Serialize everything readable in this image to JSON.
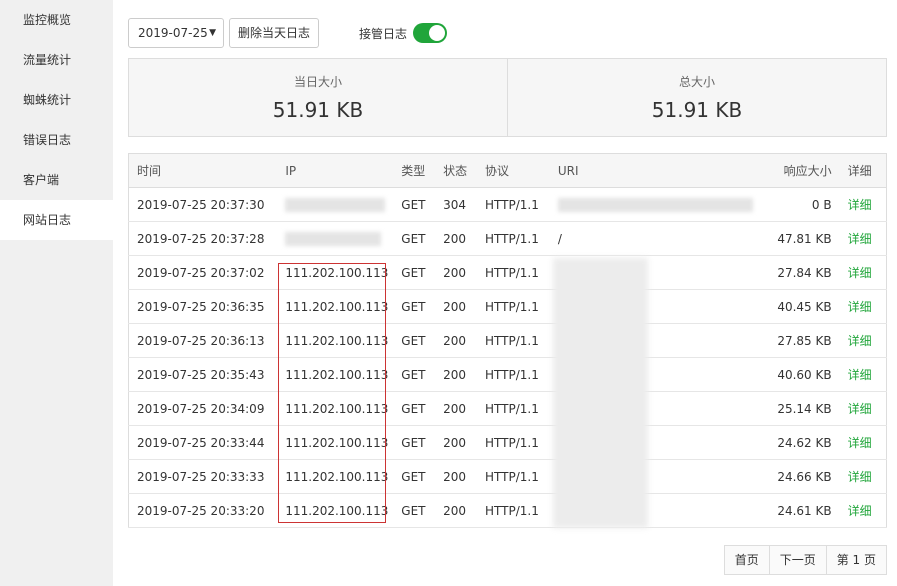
{
  "sidebar": {
    "items": [
      {
        "label": "监控概览"
      },
      {
        "label": "流量统计"
      },
      {
        "label": "蜘蛛统计"
      },
      {
        "label": "错误日志"
      },
      {
        "label": "客户端"
      },
      {
        "label": "网站日志",
        "active": true
      }
    ]
  },
  "toolbar": {
    "date_value": "2019-07-25",
    "delete_label": "删除当天日志",
    "toggle_label": "接管日志",
    "toggle_on": true
  },
  "stats": {
    "today_label": "当日大小",
    "today_value": "51.91 KB",
    "total_label": "总大小",
    "total_value": "51.91 KB"
  },
  "table": {
    "headers": {
      "time": "时间",
      "ip": "IP",
      "type": "类型",
      "status": "状态",
      "protocol": "协议",
      "uri": "URI",
      "size": "响应大小",
      "detail": "详细"
    },
    "rows": [
      {
        "time": "2019-07-25 20:37:30",
        "ip": "",
        "type": "GET",
        "status": "304",
        "protocol": "HTTP/1.1",
        "uri": "",
        "size": "0 B",
        "detail": "详细"
      },
      {
        "time": "2019-07-25 20:37:28",
        "ip": "",
        "type": "GET",
        "status": "200",
        "protocol": "HTTP/1.1",
        "uri": "/",
        "size": "47.81 KB",
        "detail": "详细"
      },
      {
        "time": "2019-07-25 20:37:02",
        "ip": "111.202.100.113",
        "type": "GET",
        "status": "200",
        "protocol": "HTTP/1.1",
        "uri": "",
        "size": "27.84 KB",
        "detail": "详细"
      },
      {
        "time": "2019-07-25 20:36:35",
        "ip": "111.202.100.113",
        "type": "GET",
        "status": "200",
        "protocol": "HTTP/1.1",
        "uri": "",
        "size": "40.45 KB",
        "detail": "详细"
      },
      {
        "time": "2019-07-25 20:36:13",
        "ip": "111.202.100.113",
        "type": "GET",
        "status": "200",
        "protocol": "HTTP/1.1",
        "uri": "",
        "size": "27.85 KB",
        "detail": "详细"
      },
      {
        "time": "2019-07-25 20:35:43",
        "ip": "111.202.100.113",
        "type": "GET",
        "status": "200",
        "protocol": "HTTP/1.1",
        "uri": "",
        "size": "40.60 KB",
        "detail": "详细"
      },
      {
        "time": "2019-07-25 20:34:09",
        "ip": "111.202.100.113",
        "type": "GET",
        "status": "200",
        "protocol": "HTTP/1.1",
        "uri": "",
        "size": "25.14 KB",
        "detail": "详细"
      },
      {
        "time": "2019-07-25 20:33:44",
        "ip": "111.202.100.113",
        "type": "GET",
        "status": "200",
        "protocol": "HTTP/1.1",
        "uri": "",
        "size": "24.62 KB",
        "detail": "详细"
      },
      {
        "time": "2019-07-25 20:33:33",
        "ip": "111.202.100.113",
        "type": "GET",
        "status": "200",
        "protocol": "HTTP/1.1",
        "uri": "",
        "size": "24.66 KB",
        "detail": "详细"
      },
      {
        "time": "2019-07-25 20:33:20",
        "ip": "111.202.100.113",
        "type": "GET",
        "status": "200",
        "protocol": "HTTP/1.1",
        "uri": "",
        "size": "24.61 KB",
        "detail": "详细"
      }
    ]
  },
  "pager": {
    "first": "首页",
    "next": "下一页",
    "current": "第 1 页"
  },
  "colors": {
    "accent": "#20a53a",
    "highlight_border": "#cc3333"
  }
}
